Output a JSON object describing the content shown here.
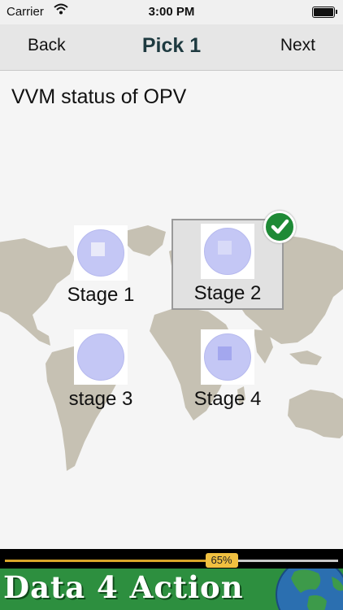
{
  "status_bar": {
    "carrier": "Carrier",
    "time": "3:00 PM"
  },
  "nav": {
    "back_label": "Back",
    "title": "Pick 1",
    "next_label": "Next"
  },
  "question": "VVM status of OPV",
  "options": [
    {
      "label": "Stage 1",
      "selected": false,
      "square_color": "#e9eaf9"
    },
    {
      "label": "Stage 2",
      "selected": true,
      "square_color": "#d8daf8"
    },
    {
      "label": "stage 3",
      "selected": false,
      "square_color": null
    },
    {
      "label": "Stage 4",
      "selected": false,
      "square_color": "#a3a7ee"
    }
  ],
  "ad": {
    "progress_percent": 65,
    "progress_label": "65%",
    "brand_text": "Data 4 Action"
  },
  "colors": {
    "nav_title": "#1e3a40",
    "selection_check": "#1e8a36",
    "ad_band": "#2d8f3f",
    "vvm_circle": "#c4c7f5"
  }
}
